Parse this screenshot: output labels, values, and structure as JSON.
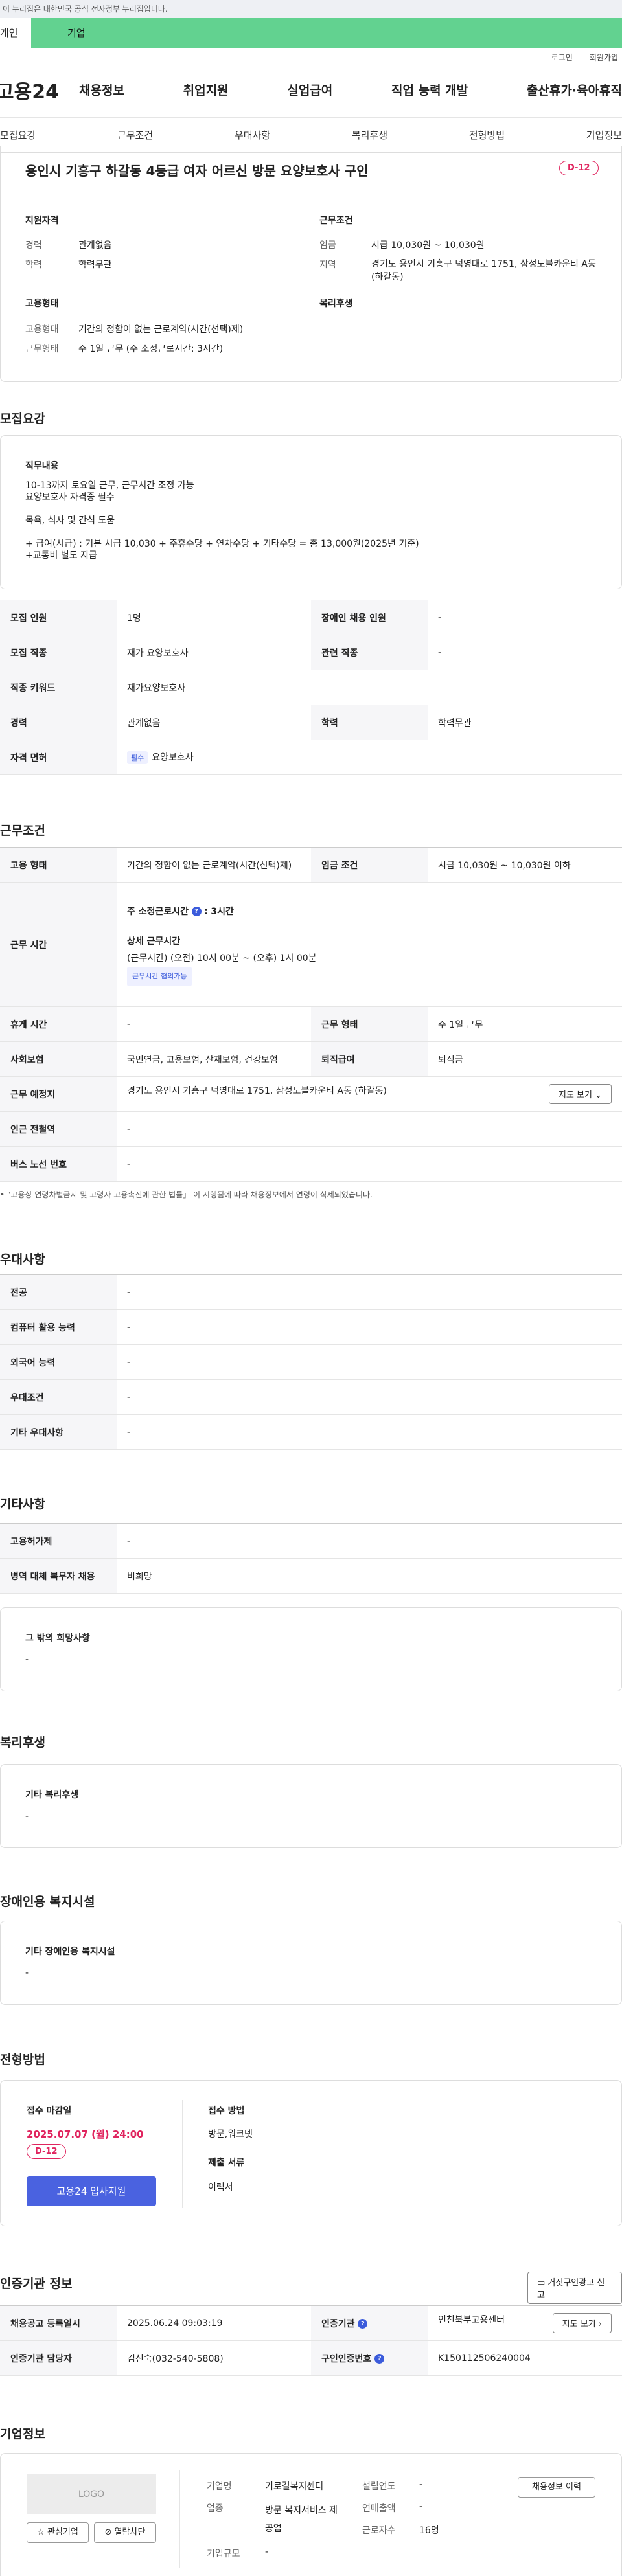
{
  "gov_banner": "이 누리집은 대한민국 공식 전자정부 누리집입니다.",
  "user_tabs": [
    "개인",
    "기업"
  ],
  "util_links": [
    "로그인",
    "회원가입"
  ],
  "logo": "고용24",
  "gnb": [
    "채용정보",
    "취업지원",
    "실업급여",
    "직업 능력 개발",
    "출산휴가·육아휴직"
  ],
  "snb": [
    "모집요강",
    "근무조건",
    "우대사항",
    "복리후생",
    "전형방법",
    "기업정보"
  ],
  "job": {
    "title": "용인시 기흥구 하갈동 4등급 여자 어르신 방문 요양보호사 구인",
    "dday": "D-12"
  },
  "summary": {
    "qual_title": "지원자격",
    "exp_label": "경력",
    "exp": "관계없음",
    "edu_label": "학력",
    "edu": "학력무관",
    "cond_title": "근무조건",
    "wage_label": "임금",
    "wage": "시급 10,030원 ~ 10,030원",
    "loc_label": "지역",
    "loc": "경기도 용인시 기흥구 덕영대로 1751, 삼성노블카운티 A동 (하갈동)",
    "emp_title": "고용형태",
    "emptype_label": "고용형태",
    "emptype": "기간의 정함이 없는 근로계약(시간(선택)제)",
    "worktime_label": "근무형태",
    "worktime": "주 1일 근무 (주 소정근로시간: 3시간)",
    "welfare_title": "복리후생"
  },
  "recruit": {
    "heading": "모집요강",
    "duty_title": "직무내용",
    "duty_lines": [
      "10-13까지 토요일 근무, 근무시간 조정 가능",
      "요양보호사 자격증 필수",
      "",
      "목욕, 식사 및 간식 도움",
      "",
      "+ 급여(시급) : 기본 시급 10,030 + 주휴수당 + 연차수당 + 기타수당 = 총 13,000원(2025년 기준)",
      "+교통비 별도 지급"
    ],
    "rows": {
      "headcount_k": "모집 인원",
      "headcount": "1명",
      "disabled_k": "장애인 채용 인원",
      "disabled": "-",
      "job_k": "모집 직종",
      "job": "재가 요양보호사",
      "related_k": "관련 직종",
      "related": "-",
      "keyword_k": "직종 키워드",
      "keyword": "재가요양보호사",
      "career_k": "경력",
      "career": "관계없음",
      "edu_k": "학력",
      "edu": "학력무관",
      "license_k": "자격 면허",
      "license_chip": "필수",
      "license": "요양보호사"
    }
  },
  "cond": {
    "heading": "근무조건",
    "emp_k": "고용 형태",
    "emp": "기간의 정함이 없는 근로계약(시간(선택)제)",
    "wage_k": "임금 조건",
    "wage": "시급 10,030원 ~ 10,030원 이하",
    "time_k": "근무 시간",
    "time_main": "주 소정근로시간",
    "time_main_val": ": 3시간",
    "time_detail_title": "상세 근무시간",
    "time_detail": "(근무시간) (오전) 10시 00분 ~ (오후) 1시 00분",
    "time_chip": "근무시간 협의가능",
    "rest_k": "휴게 시간",
    "rest": "-",
    "form_k": "근무 형태",
    "form": "주 1일 근무",
    "ins_k": "사회보험",
    "ins": "국민연금, 고용보험, 산재보험, 건강보험",
    "sev_k": "퇴직급여",
    "sev": "퇴직금",
    "place_k": "근무 예정지",
    "place": "경기도 용인시 기흥구 덕영대로 1751, 삼성노블카운티 A동 (하갈동)",
    "map_btn": "지도 보기",
    "subway_k": "인근 전철역",
    "subway": "-",
    "bus_k": "버스 노선 번호",
    "bus": "-",
    "note": "\"고용상 연령차별금지 및 고령자 고용촉진에 관한 법률」 이 시행됨에 따라 채용정보에서 연령이 삭제되었습니다."
  },
  "pref": {
    "heading": "우대사항",
    "rows": [
      {
        "k": "전공",
        "v": "-"
      },
      {
        "k": "컴퓨터 활용 능력",
        "v": "-"
      },
      {
        "k": "외국어 능력",
        "v": "-"
      },
      {
        "k": "우대조건",
        "v": "-"
      },
      {
        "k": "기타 우대사항",
        "v": "-"
      }
    ]
  },
  "etc": {
    "heading": "기타사항",
    "rows": [
      {
        "k": "고용허가제",
        "v": "-"
      },
      {
        "k": "병역 대체 복무자 채용",
        "v": "비희망"
      }
    ],
    "hope_title": "그 밖의 희망사항",
    "hope": "-"
  },
  "welfare": {
    "heading": "복리후생",
    "title": "기타 복리후생",
    "value": "-"
  },
  "disabled_fac": {
    "heading": "장애인용 복지시설",
    "title": "기타 장애인용 복지시설",
    "value": "-"
  },
  "process": {
    "heading": "전형방법",
    "deadline_title": "접수 마감일",
    "deadline": "2025.07.07 (월) 24:00",
    "dday": "D-12",
    "apply_btn": "고용24 입사지원",
    "method_title": "접수 방법",
    "method": "방문,워크넷",
    "docs_title": "제출 서류",
    "docs": "이력서"
  },
  "agency": {
    "heading": "인증기관 정보",
    "report_btn": "거짓구인광고 신고",
    "reg_k": "채용공고 등록일시",
    "reg": "2025.06.24 09:03:19",
    "org_k": "인증기관",
    "org": "인천북부고용센터",
    "map_btn": "지도 보기",
    "mgr_k": "인증기관 담당자",
    "mgr": "김선숙(032-540-5808)",
    "cert_k": "구인인증번호",
    "cert": "K150112506240004"
  },
  "company": {
    "heading": "기업정보",
    "logo": "LOGO",
    "fav_btn": "관심기업",
    "block_btn": "열람차단",
    "name_k": "기업명",
    "name": "기로길복지센터",
    "year_k": "설립연도",
    "year": "-",
    "history_btn": "채용정보 이력",
    "ind_k": "업종",
    "ind": "방문 복지서비스 제공업",
    "sales_k": "연매출액",
    "sales": "-",
    "emp_k": "근로자수",
    "emp": "16명",
    "size_k": "기업규모",
    "size": "-"
  }
}
